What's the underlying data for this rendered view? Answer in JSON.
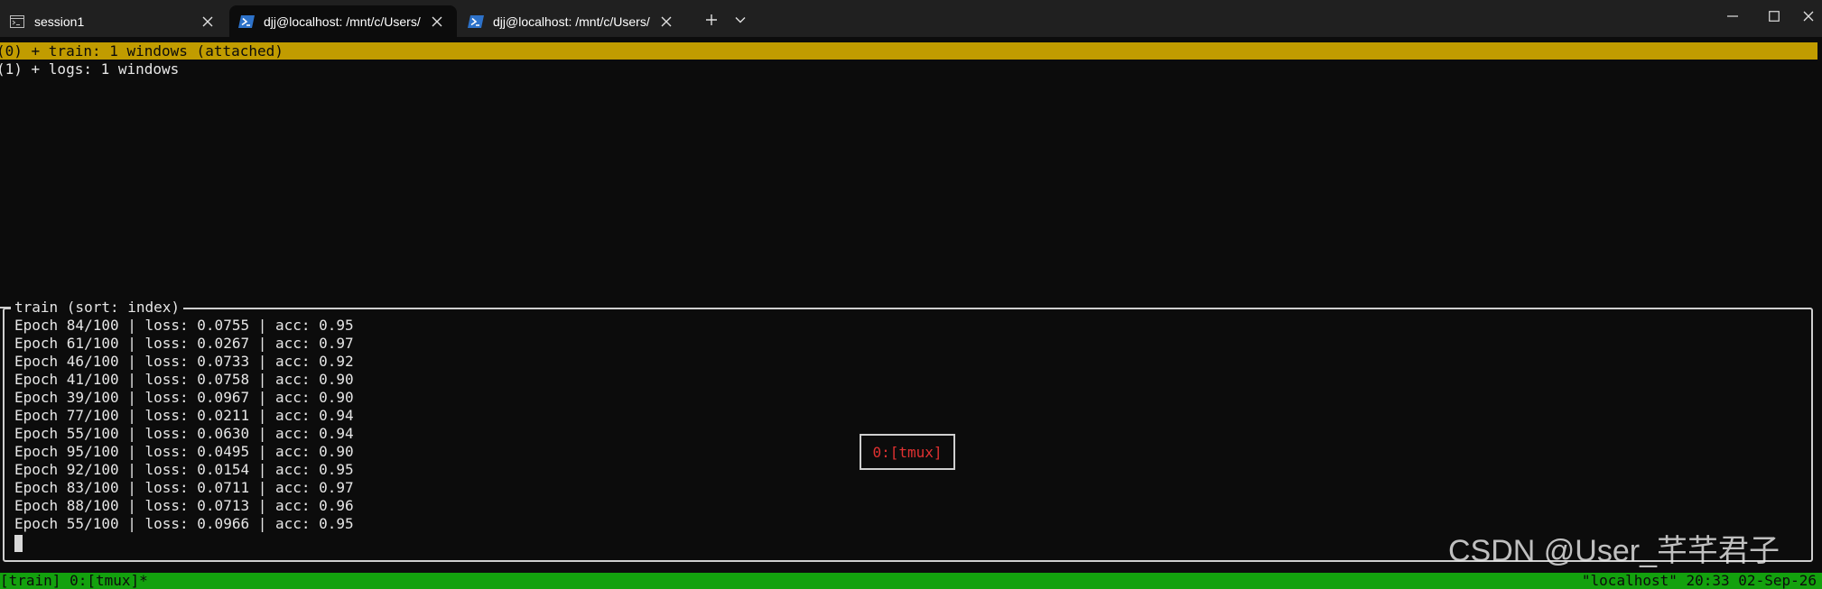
{
  "tabs": [
    {
      "title": "session1",
      "icon": "console-icon",
      "active": false
    },
    {
      "title": "djj@localhost: /mnt/c/Users/d",
      "icon": "powershell-icon",
      "active": true
    },
    {
      "title": "djj@localhost: /mnt/c/Users/djj",
      "icon": "powershell-icon",
      "active": false
    }
  ],
  "tmux": {
    "sessions": [
      "(0) + train: 1 windows (attached)",
      "(1) + logs: 1 windows"
    ],
    "pane_title": "train (sort: index)",
    "log_lines": [
      "Epoch 84/100 | loss: 0.0755 | acc: 0.95",
      "Epoch 61/100 | loss: 0.0267 | acc: 0.97",
      "Epoch 46/100 | loss: 0.0733 | acc: 0.92",
      "Epoch 41/100 | loss: 0.0758 | acc: 0.90",
      "Epoch 39/100 | loss: 0.0967 | acc: 0.90",
      "Epoch 77/100 | loss: 0.0211 | acc: 0.94",
      "Epoch 55/100 | loss: 0.0630 | acc: 0.94",
      "Epoch 95/100 | loss: 0.0495 | acc: 0.90",
      "Epoch 92/100 | loss: 0.0154 | acc: 0.95",
      "Epoch 83/100 | loss: 0.0711 | acc: 0.97",
      "Epoch 88/100 | loss: 0.0713 | acc: 0.96",
      "Epoch 55/100 | loss: 0.0966 | acc: 0.95"
    ],
    "preview_label": "0:[tmux]",
    "status_left": "[train] 0:[tmux]*",
    "status_right": "\"localhost\" 20:33 02-Sep-26"
  },
  "watermark": "CSDN @User_芊芊君子",
  "colors": {
    "session_highlight": "#c19c00",
    "status_bar": "#13a10e",
    "preview_text": "#e03131",
    "terminal_bg": "#0c0c0c"
  }
}
